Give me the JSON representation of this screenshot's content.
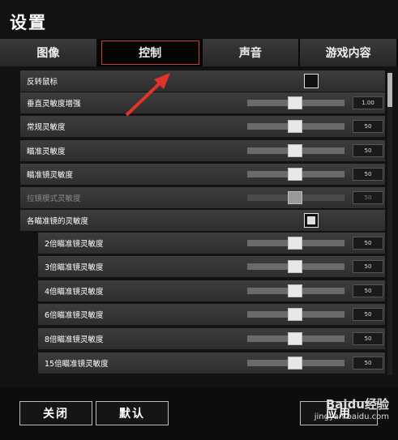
{
  "window": {
    "title": "设置"
  },
  "tabs": [
    {
      "label": "图像"
    },
    {
      "label": "控制"
    },
    {
      "label": "声音"
    },
    {
      "label": "游戏内容"
    }
  ],
  "active_tab": "控制",
  "settings": [
    {
      "label": "反转鼠标",
      "type": "checkbox",
      "checked": false
    },
    {
      "label": "垂直灵敏度增强",
      "type": "slider",
      "value": "1.00"
    },
    {
      "label": "常规灵敏度",
      "type": "slider",
      "value": "50"
    },
    {
      "label": "瞄准灵敏度",
      "type": "slider",
      "value": "50"
    },
    {
      "label": "瞄准镜灵敏度",
      "type": "slider",
      "value": "50"
    },
    {
      "label": "拉镜模式灵敏度",
      "type": "slider",
      "value": "50",
      "disabled": true
    },
    {
      "label": "各瞄准镜的灵敏度",
      "type": "checkbox",
      "checked": true
    },
    {
      "label": "2倍瞄准镜灵敏度",
      "type": "slider",
      "value": "50",
      "sub": true
    },
    {
      "label": "3倍瞄准镜灵敏度",
      "type": "slider",
      "value": "50",
      "sub": true
    },
    {
      "label": "4倍瞄准镜灵敏度",
      "type": "slider",
      "value": "50",
      "sub": true
    },
    {
      "label": "6倍瞄准镜灵敏度",
      "type": "slider",
      "value": "50",
      "sub": true
    },
    {
      "label": "8倍瞄准镜灵敏度",
      "type": "slider",
      "value": "50",
      "sub": true
    },
    {
      "label": "15倍瞄准镜灵敏度",
      "type": "slider",
      "value": "50",
      "sub": true
    }
  ],
  "footer": {
    "close_label": "关闭",
    "default_label": "默认",
    "apply_label": "应用"
  },
  "watermark": {
    "site": "Baidu经验",
    "url": "jingyan.baidu.com"
  },
  "colors": {
    "accent_red": "#d23a3a",
    "background": "#121212",
    "row": "#353535"
  }
}
